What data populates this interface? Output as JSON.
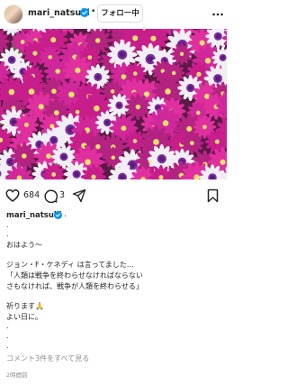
{
  "header": {
    "username": "mari_natsuki",
    "separator": "•",
    "follow_label": "フォロー中"
  },
  "post": {
    "like_count": "684",
    "comment_count": "3",
    "caption_username": "mari_natsuki",
    "caption_first": ".",
    "caption_lines": [
      ".",
      ".",
      "おはよう～",
      "ジョン・F・ケネディ は言ってました…",
      "「人類は戦争を終わらせなければならない",
      "さもなければ、戦争が人類を終わらせる」",
      "祈ります🙏",
      "よい日に。",
      ".",
      ".",
      "."
    ],
    "view_comments": "コメント3件をすべて見る",
    "timestamp": "2時間前"
  },
  "icons": {
    "more": "more-icon",
    "heart": "heart-icon",
    "comment": "comment-icon",
    "share": "share-icon",
    "save": "bookmark-icon",
    "verified": "verified-badge-icon"
  },
  "colors": {
    "verified": "#0095f6",
    "secondary_text": "#8e8e8e",
    "primary_text": "#262626"
  }
}
